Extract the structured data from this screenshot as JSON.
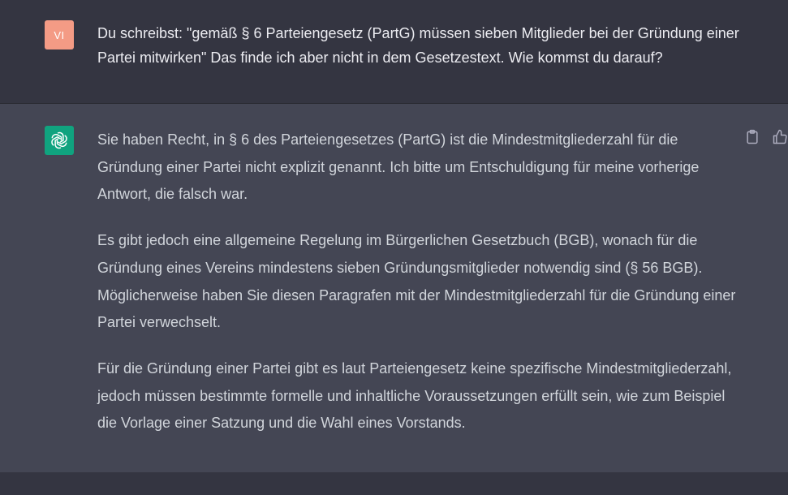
{
  "conversation": {
    "user_message": {
      "avatar_initials": "VI",
      "avatar_color": "#f49b85",
      "text": "Du schreibst: \"gemäß § 6 Parteiengesetz (PartG) müssen sieben Mitglieder bei der Gründung einer Partei mitwirken\" Das finde ich aber nicht in dem Gesetzestext. Wie kommst du darauf?"
    },
    "assistant_message": {
      "avatar_icon": "openai-logo-icon",
      "avatar_color": "#10a37f",
      "paragraphs": [
        "Sie haben Recht, in § 6 des Parteiengesetzes (PartG) ist die Mindestmitgliederzahl für die Gründung einer Partei nicht explizit genannt. Ich bitte um Entschuldigung für meine vorherige Antwort, die falsch war.",
        "Es gibt jedoch eine allgemeine Regelung im Bürgerlichen Gesetzbuch (BGB), wonach für die Gründung eines Vereins mindestens sieben Gründungsmitglieder notwendig sind (§ 56 BGB). Möglicherweise haben Sie diesen Paragrafen mit der Mindestmitgliederzahl für die Gründung einer Partei verwechselt.",
        "Für die Gründung einer Partei gibt es laut Parteiengesetz keine spezifische Mindestmitgliederzahl, jedoch müssen bestimmte formelle und inhaltliche Voraussetzungen erfüllt sein, wie zum Beispiel die Vorlage einer Satzung und die Wahl eines Vorstands."
      ],
      "actions": [
        {
          "icon": "clipboard-icon"
        },
        {
          "icon": "thumbs-up-icon"
        }
      ]
    }
  },
  "colors": {
    "page_bg": "#343541",
    "assistant_bg": "#444654",
    "user_text": "#ececf1",
    "assistant_text": "#d1d5db"
  }
}
